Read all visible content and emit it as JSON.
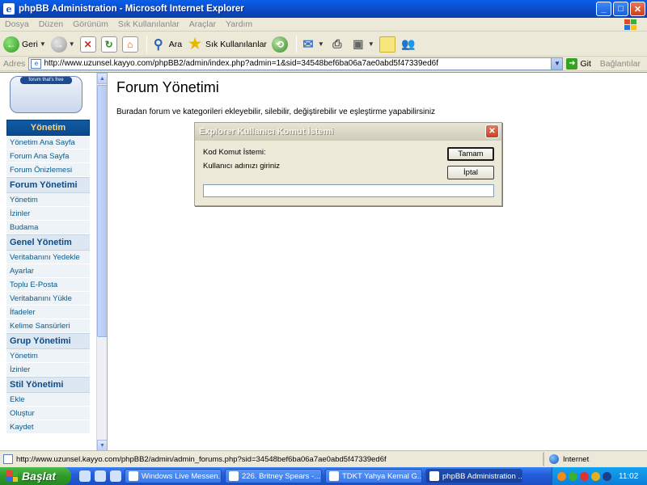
{
  "window": {
    "title": "phpBB Administration - Microsoft Internet Explorer",
    "controls": [
      "minimize-icon",
      "maximize-icon",
      "close-icon"
    ]
  },
  "menu": [
    "Dosya",
    "Düzen",
    "Görünüm",
    "Sık Kullanılanlar",
    "Araçlar",
    "Yardım"
  ],
  "toolbar": {
    "back_label": "Geri",
    "search_label": "Ara",
    "favorites_label": "Sık Kullanılanlar"
  },
  "address": {
    "label": "Adres",
    "url": "http://www.uzunsel.kayyo.com/phpBB2/admin/index.php?admin=1&sid=34548bef6ba06a7ae0abd5f47339ed6f",
    "go_label": "Git",
    "links_label": "Bağlantılar"
  },
  "sidebar": {
    "logo_text": "phpbb",
    "logo_tagline": "forum that's free",
    "header": "Yönetim",
    "top_items": [
      "Yönetim Ana Sayfa",
      "Forum Ana Sayfa",
      "Forum Önizlemesi"
    ],
    "sections": [
      {
        "title": "Forum Yönetimi",
        "items": [
          "Yönetim",
          "İzinler",
          "Budama"
        ]
      },
      {
        "title": "Genel Yönetim",
        "items": [
          "Veritabanını Yedekle",
          "Ayarlar",
          "Toplu E-Posta",
          "Veritabanını Yükle",
          "İfadeler",
          "Kelime Sansürleri"
        ]
      },
      {
        "title": "Grup Yönetimi",
        "items": [
          "Yönetim",
          "İzinler"
        ]
      },
      {
        "title": "Stil Yönetimi",
        "items": [
          "Ekle",
          "Oluştur",
          "Kaydet"
        ]
      }
    ]
  },
  "main": {
    "title": "Forum Yönetimi",
    "description": "Buradan forum ve kategorileri ekleyebilir, silebilir, değiştirebilir ve eşleştirme yapabilirsiniz"
  },
  "dialog": {
    "title": "Explorer Kullanıcı Komut İstemi",
    "prompt_label": "Kod Komut İstemi:",
    "message": "Kullanıcı adınızı giriniz",
    "ok_label": "Tamam",
    "cancel_label": "İptal",
    "input_value": ""
  },
  "status": {
    "text": "http://www.uzunsel.kayyo.com/phpBB2/admin/admin_forums.php?sid=34548bef6ba06a7ae0abd5f47339ed6f",
    "zone": "Internet"
  },
  "taskbar": {
    "start_label": "Başlat",
    "tasks": [
      "Windows Live Messen...",
      "226. Britney Spears -...",
      "TDKT Yahya Kemal G...",
      "phpBB Administration ..."
    ],
    "clock": "11:02"
  }
}
